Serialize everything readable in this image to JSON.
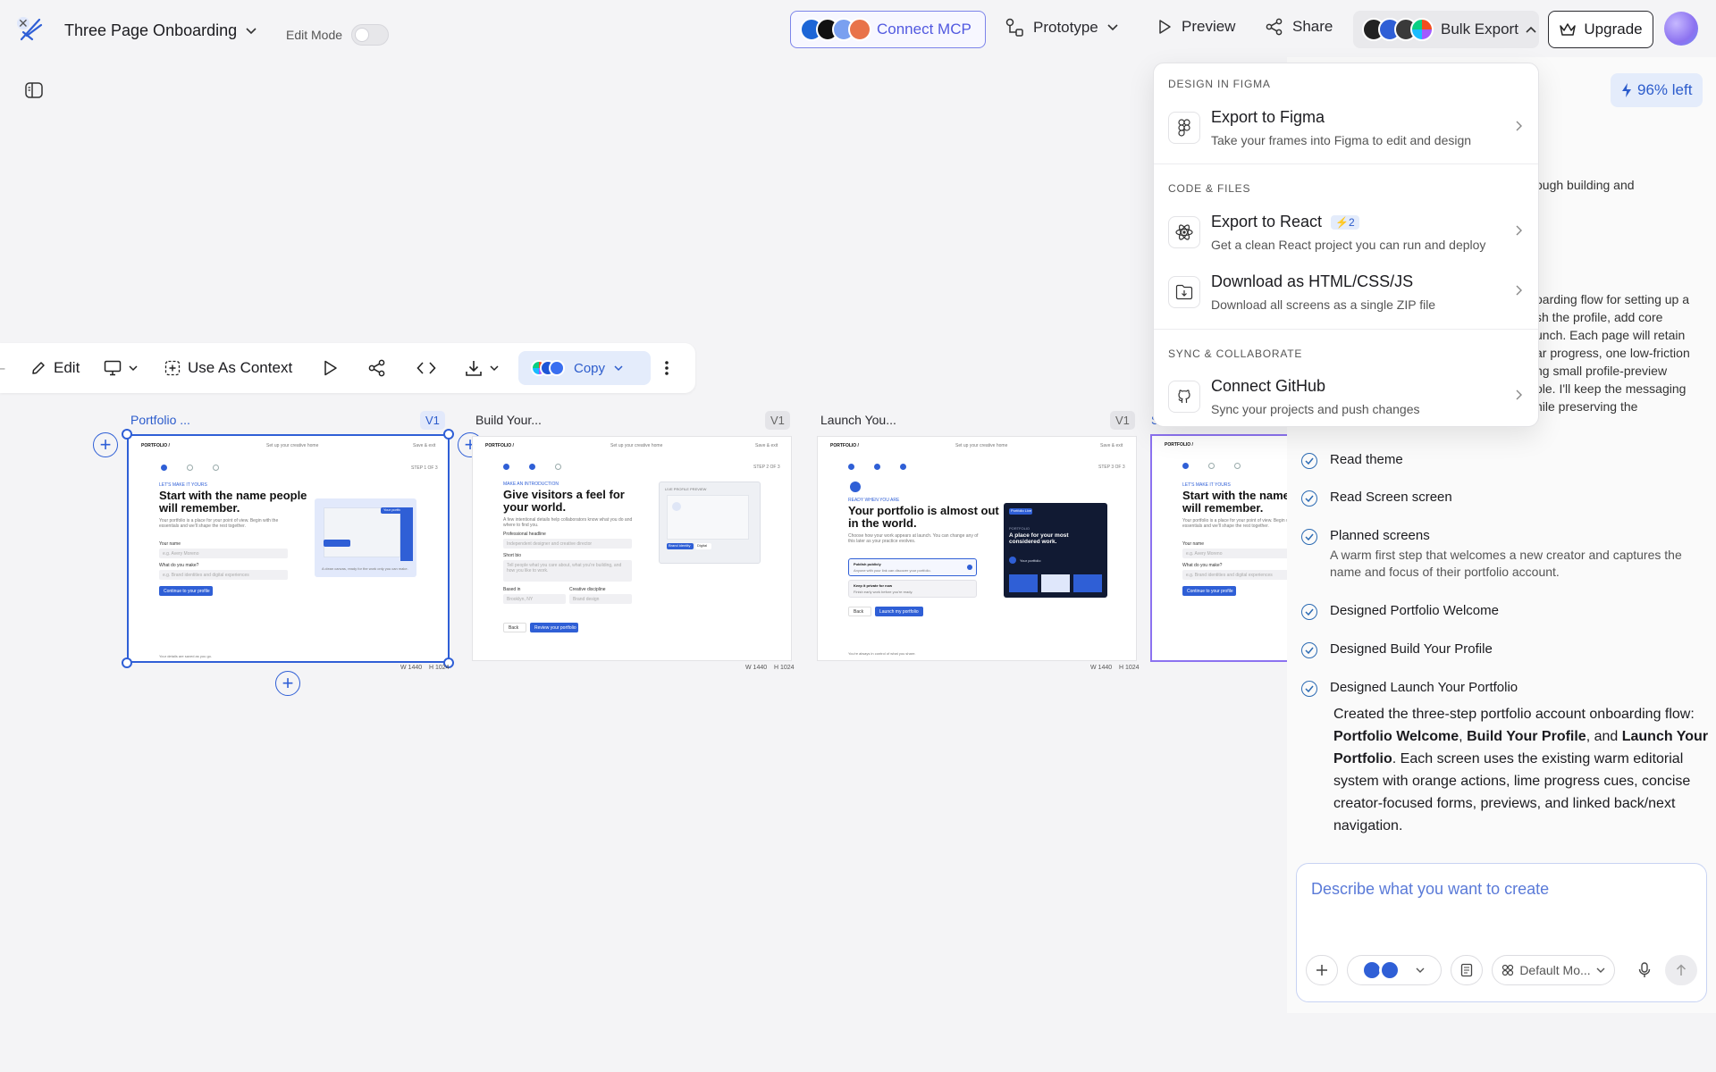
{
  "topbar": {
    "project_title": "Three Page Onboarding",
    "edit_mode_label": "Edit Mode",
    "connect_mcp_label": "Connect MCP",
    "prototype_label": "Prototype",
    "preview_label": "Preview",
    "share_label": "Share",
    "bulk_export_label": "Bulk Export",
    "upgrade_label": "Upgrade"
  },
  "canvas_toolbar": {
    "edit_label": "Edit",
    "use_as_context_label": "Use As Context",
    "copy_label": "Copy"
  },
  "frames": [
    {
      "label": "Portfolio ...",
      "version": "V1",
      "width_label": "W 1440",
      "height_label": "H 1024",
      "brand": "PORTFOLIO /",
      "top_center": "Set up your creative home",
      "top_right": "Save & exit",
      "step": "STEP 1 OF 3",
      "eyebrow": "LET'S MAKE IT YOURS",
      "heading": "Start with the name people will remember.",
      "body": "Your portfolio is a place for your point of view. Begin with the essentials and we'll shape the rest together.",
      "field1_label": "Your name",
      "field1_placeholder": "e.g. Avery Moreno",
      "field2_label": "What do you make?",
      "field2_placeholder": "e.g. Brand identities and digital experiences",
      "cta": "Continue to your profile",
      "preview_badge": "Your portfolio",
      "preview_caption": "A clean canvas, ready for the work only you can make.",
      "footer": "Your details are saved as you go."
    },
    {
      "label": "Build Your...",
      "version": "V1",
      "width_label": "W 1440",
      "height_label": "H 1024",
      "brand": "PORTFOLIO /",
      "top_center": "Set up your creative home",
      "top_right": "Save & exit",
      "step": "STEP 2 OF 3",
      "eyebrow": "MAKE AN INTRODUCTION",
      "heading": "Give visitors a feel for your world.",
      "body": "A few intentional details help collaborators know what you do and where to find you.",
      "field1_label": "Professional headline",
      "field1_placeholder": "Independent designer and creative director",
      "field2_label": "Short bio",
      "field2_placeholder": "Tell people what you care about, what you're building, and how you like to work.",
      "field3_label": "Based in",
      "field3_placeholder": "Brooklyn, NY",
      "field4_label": "Creative discipline",
      "field4_placeholder": "Brand design",
      "back": "Back",
      "cta": "Review your portfolio",
      "preview_title": "LIVE PROFILE PREVIEW",
      "preview_tag1": "Brand identity",
      "preview_tag2": "Digital"
    },
    {
      "label": "Launch You...",
      "version": "V1",
      "width_label": "W 1440",
      "height_label": "H 1024",
      "brand": "PORTFOLIO /",
      "top_center": "Set up your creative home",
      "top_right": "Save & exit",
      "step": "STEP 3 OF 3",
      "eyebrow": "READY WHEN YOU ARE",
      "heading": "Your portfolio is almost out in the world.",
      "body": "Choose how your work appears at launch. You can change any of this later as your practice evolves.",
      "option1": "Publish publicly",
      "option1_desc": "Anyone with your link can discover your portfolio.",
      "option2": "Keep it private for now",
      "option2_desc": "Finish early work before you're ready.",
      "back": "Back",
      "cta": "Launch my portfolio",
      "dark_badge": "Portfolio Live",
      "dark_eyebrow": "PORTFOLIO",
      "dark_heading": "A place for your most considered work.",
      "dark_caption": "Your portfolio",
      "footer": "You're always in control of what you share."
    },
    {
      "label": "S",
      "brand": "PORTFOLIO /",
      "eyebrow": "LET'S MAKE IT YOURS",
      "heading": "Start with the name people will remember.",
      "body": "Your portfolio is a place for your point of view. Begin with the essentials and we'll shape the rest together.",
      "field1_label": "Your name",
      "field1_placeholder": "e.g. Avery Moreno",
      "field2_label": "What do you make?",
      "field2_placeholder": "e.g. Brand identities and digital experiences",
      "cta": "Continue to your profile"
    }
  ],
  "export_menu": {
    "sections": [
      {
        "title": "DESIGN IN FIGMA",
        "items": [
          {
            "title": "Export to Figma",
            "desc": "Take your frames into Figma to edit and design",
            "icon": "figma-icon"
          }
        ]
      },
      {
        "title": "CODE & FILES",
        "items": [
          {
            "title": "Export to React",
            "badge": "⚡2",
            "desc": "Get a clean React project you can run and deploy",
            "icon": "react-icon"
          },
          {
            "title": "Download as HTML/CSS/JS",
            "desc": "Download all screens as a single ZIP file",
            "icon": "folder-download-icon"
          }
        ]
      },
      {
        "title": "SYNC & COLLABORATE",
        "items": [
          {
            "title": "Connect GitHub",
            "desc": "Sync your projects and push changes",
            "icon": "github-icon"
          }
        ]
      }
    ]
  },
  "chat": {
    "credits_left": "96% left",
    "partial_lines_1": [
      "ough building and"
    ],
    "partial_lines_2": [
      "oarding flow for setting up a",
      "sh the profile, add core",
      "unch. Each page will retain",
      "ar progress, one low-friction",
      "ng small profile-preview",
      "ole. I'll keep the messaging",
      "hile preserving the"
    ],
    "steps": [
      {
        "title": "Read theme",
        "desc": ""
      },
      {
        "title": "Read Screen screen",
        "desc": ""
      },
      {
        "title": "Planned screens",
        "desc": "A warm first step that welcomes a new creator and captures the name and focus of their portfolio account."
      },
      {
        "title": "Designed Portfolio Welcome",
        "desc": ""
      },
      {
        "title": "Designed Build Your Profile",
        "desc": ""
      },
      {
        "title": "Designed Launch Your Portfolio",
        "desc": ""
      }
    ],
    "summary_parts": {
      "p1": "Created the three-step portfolio account onboarding flow: ",
      "b1": "Portfolio Welcome",
      "p2": ", ",
      "b2": "Build Your Profile",
      "p3": ", and ",
      "b3": "Launch Your Portfolio",
      "p4": ". Each screen uses the existing warm editorial system with orange actions, lime progress cues, concise creator-focused forms, previews, and linked back/next navigation."
    },
    "prompt_placeholder": "Describe what you want to create",
    "model_label": "Default Mo..."
  },
  "colors": {
    "accent": "#2f5fd6",
    "mcp_border": "#7c84ea",
    "selection": "#2f5fd6",
    "purple_frame": "#8c72f0"
  }
}
